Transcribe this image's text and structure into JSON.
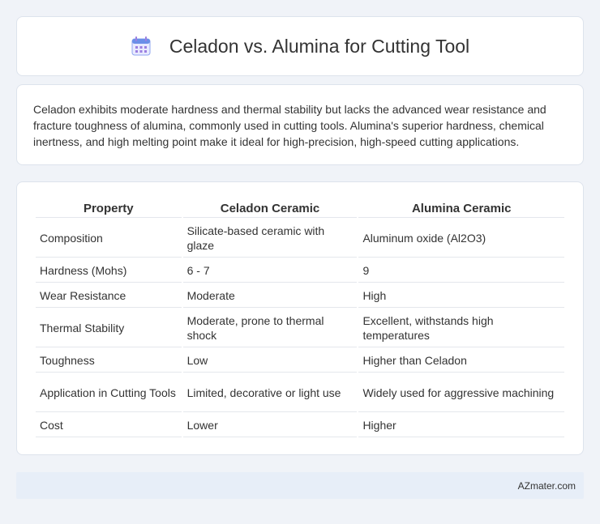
{
  "header": {
    "title": "Celadon vs. Alumina for Cutting Tool",
    "icon": "calendar-icon"
  },
  "description": "Celadon exhibits moderate hardness and thermal stability but lacks the advanced wear resistance and fracture toughness of alumina, commonly used in cutting tools. Alumina's superior hardness, chemical inertness, and high melting point make it ideal for high-precision, high-speed cutting applications.",
  "table": {
    "headers": [
      "Property",
      "Celadon Ceramic",
      "Alumina Ceramic"
    ],
    "rows": [
      [
        "Composition",
        "Silicate-based ceramic with glaze",
        "Aluminum oxide (Al2O3)"
      ],
      [
        "Hardness (Mohs)",
        "6 - 7",
        "9"
      ],
      [
        "Wear Resistance",
        "Moderate",
        "High"
      ],
      [
        "Thermal Stability",
        "Moderate, prone to thermal shock",
        "Excellent, withstands high temperatures"
      ],
      [
        "Toughness",
        "Low",
        "Higher than Celadon"
      ],
      [
        "Application in Cutting Tools",
        "Limited, decorative or light use",
        "Widely used for aggressive machining"
      ],
      [
        "Cost",
        "Lower",
        "Higher"
      ]
    ]
  },
  "footer": {
    "text": "AZmater.com"
  },
  "colors": {
    "background": "#f0f3f8",
    "footer_bg": "#e7eef8",
    "icon_blue": "#6a8fe8",
    "icon_purple": "#9b7fe0"
  }
}
